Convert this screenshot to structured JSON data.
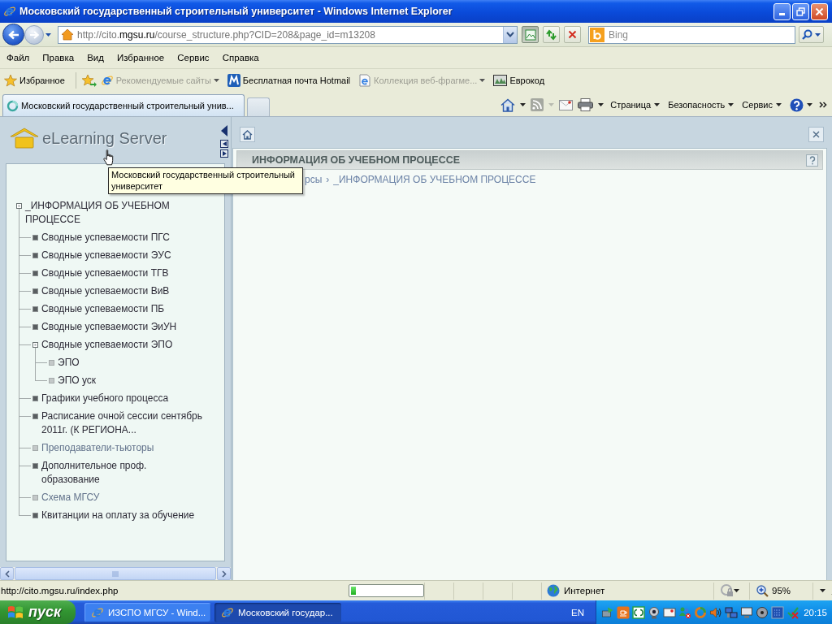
{
  "window": {
    "title": "Московский государственный строительный университет - Windows Internet Explorer"
  },
  "address_bar": {
    "url_start": "http://cito.",
    "url_domain": "mgsu.ru",
    "url_end": "/course_structure.php?CID=208&page_id=m13208"
  },
  "search": {
    "placeholder": "Bing"
  },
  "menu": [
    "Файл",
    "Правка",
    "Вид",
    "Избранное",
    "Сервис",
    "Справка"
  ],
  "favorites_bar": {
    "favorites": "Избранное",
    "links": [
      {
        "kind": "ie",
        "label": "Рекомендуемые сайты",
        "dropdown": true,
        "disabled": true
      },
      {
        "kind": "mail",
        "label": "Бесплатная почта Hotmail",
        "dropdown": false,
        "disabled": false
      },
      {
        "kind": "webslice",
        "label": "Коллекция веб-фрагме...",
        "dropdown": true,
        "disabled": true
      },
      {
        "kind": "site",
        "label": "Еврокод",
        "dropdown": false,
        "disabled": false
      }
    ]
  },
  "tabs": [
    {
      "label": "Московский государственный строительный унив...",
      "selected": true
    }
  ],
  "command_bar": [
    "Страница",
    "Безопасность",
    "Сервис"
  ],
  "left_panel": {
    "logo": "eLearning Server",
    "tooltip": "Московский государственный строительный университет",
    "tree": [
      {
        "label": "_ИНФОРМАЦИЯ ОБ УЧЕБНОМ ПРОЦЕССЕ",
        "kind": "folder",
        "expanded": true,
        "dimmed": false,
        "children": [
          {
            "label": "Сводные успеваемости ПГС",
            "kind": "folder",
            "expanded": false,
            "dimmed": false
          },
          {
            "label": "Сводные успеваемости ЭУС",
            "kind": "folder",
            "expanded": false,
            "dimmed": false
          },
          {
            "label": "Сводные успеваемости ТГВ",
            "kind": "folder",
            "expanded": false,
            "dimmed": false
          },
          {
            "label": "Сводные успеваемости ВиВ",
            "kind": "folder",
            "expanded": false,
            "dimmed": false
          },
          {
            "label": "Сводные успеваемости ПБ",
            "kind": "folder",
            "expanded": false,
            "dimmed": false
          },
          {
            "label": "Сводные успеваемости ЭиУН",
            "kind": "folder",
            "expanded": false,
            "dimmed": false
          },
          {
            "label": "Сводные успеваемости ЭПО",
            "kind": "folder",
            "expanded": true,
            "dimmed": false,
            "children": [
              {
                "label": "ЭПО",
                "kind": "page",
                "expanded": false,
                "dimmed": false
              },
              {
                "label": "ЭПО уск",
                "kind": "page",
                "expanded": false,
                "dimmed": false
              }
            ]
          },
          {
            "label": "Графики учебного процесса",
            "kind": "folder",
            "expanded": false,
            "dimmed": false
          },
          {
            "label": "Расписание очной сессии сентябрь 2011г. (К РЕГИОНА...",
            "kind": "folder",
            "expanded": false,
            "dimmed": false
          },
          {
            "label": "Преподаватели-тьюторы",
            "kind": "page",
            "expanded": false,
            "dimmed": true
          },
          {
            "label": "Дополнительное проф. образование",
            "kind": "folder",
            "expanded": false,
            "dimmed": false
          },
          {
            "label": "Схема МГСУ",
            "kind": "page",
            "expanded": false,
            "dimmed": true
          },
          {
            "label": "Квитанции на оплату за обучение",
            "kind": "folder",
            "expanded": false,
            "dimmed": false
          }
        ]
      }
    ]
  },
  "content": {
    "title": "ИНФОРМАЦИЯ ОБ УЧЕБНОМ ПРОЦЕССЕ",
    "breadcrumb": [
      {
        "label": "рсы"
      },
      {
        "label": "_ИНФОРМАЦИЯ ОБ УЧЕБНОМ ПРОЦЕССЕ"
      }
    ],
    "breadcrumb_separator": "›"
  },
  "status_bar": {
    "text": "http://cito.mgsu.ru/index.php",
    "progress": {
      "level": 0.07
    },
    "zone": "Интернет",
    "zoom": "95%"
  },
  "taskbar": {
    "start": "пуск",
    "tasks": [
      {
        "label": "ИЗСПО МГСУ - Wind...",
        "selected": false
      },
      {
        "label": "Московский государ...",
        "selected": true
      }
    ],
    "language": "EN",
    "clock": "20:15"
  }
}
